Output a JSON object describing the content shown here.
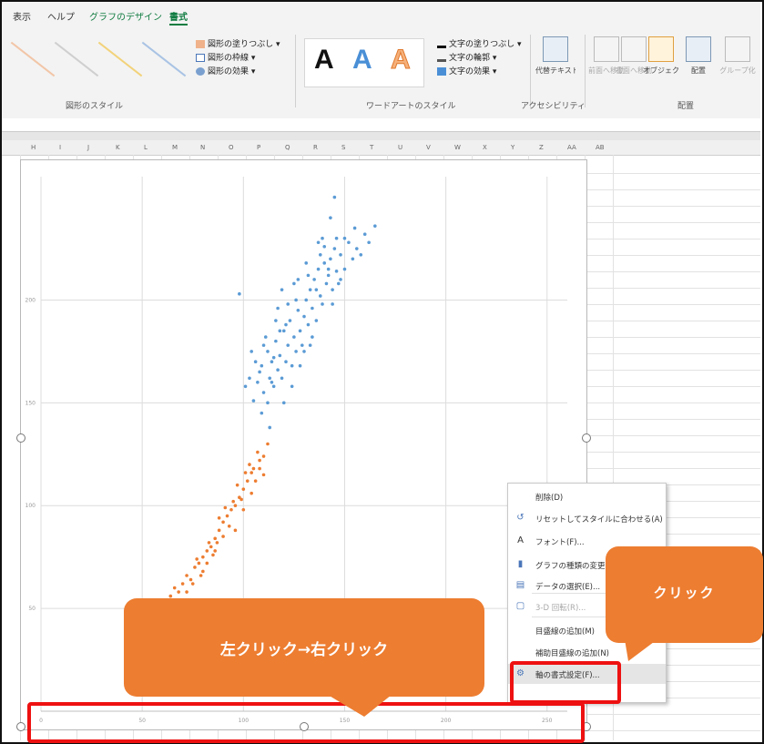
{
  "ribbon": {
    "tabs": [
      "表示",
      "ヘルプ",
      "グラフのデザイン",
      "書式"
    ],
    "shape_styles": {
      "fill": "図形の塗りつぶし",
      "outline": "図形の枠線",
      "effects": "図形の効果",
      "group_label": "図形のスタイル"
    },
    "wordart": {
      "letter": "A",
      "text_fill": "文字の塗りつぶし",
      "text_outline": "文字の輪郭",
      "text_effects": "文字の効果",
      "group_label": "ワードアートのスタイル"
    },
    "accessibility": {
      "alt_text": "代替テキスト",
      "group_label": "アクセシビリティ"
    },
    "arrange": {
      "forward": "前面へ移動",
      "backward": "背面へ移動",
      "selection_pane": "オブジェクトの選択と表示",
      "align": "配置",
      "group": "グループ化",
      "group_label": "配置"
    }
  },
  "sheet": {
    "columns": [
      "H",
      "I",
      "J",
      "K",
      "L",
      "M",
      "N",
      "O",
      "P",
      "Q",
      "R",
      "S",
      "T",
      "U",
      "V",
      "W",
      "X",
      "Y",
      "Z",
      "AA",
      "AB"
    ]
  },
  "chart_data": {
    "type": "scatter",
    "x_tick_labels": [
      "0",
      "50",
      "100",
      "150",
      "200",
      "250"
    ],
    "y_tick_labels": [
      "50",
      "100",
      "150",
      "200"
    ],
    "xlim": [
      0,
      260
    ],
    "ylim": [
      0,
      260
    ],
    "grid": true,
    "series": [
      {
        "color": "#5b9bd5",
        "points": [
          [
            98,
            203
          ],
          [
            101,
            158
          ],
          [
            105,
            151
          ],
          [
            107,
            160
          ],
          [
            109,
            168
          ],
          [
            110,
            155
          ],
          [
            112,
            175
          ],
          [
            113,
            162
          ],
          [
            114,
            170
          ],
          [
            115,
            158
          ],
          [
            116,
            180
          ],
          [
            117,
            166
          ],
          [
            118,
            173
          ],
          [
            119,
            162
          ],
          [
            120,
            185
          ],
          [
            121,
            170
          ],
          [
            122,
            178
          ],
          [
            123,
            190
          ],
          [
            124,
            168
          ],
          [
            125,
            182
          ],
          [
            126,
            175
          ],
          [
            127,
            195
          ],
          [
            128,
            185
          ],
          [
            129,
            178
          ],
          [
            130,
            192
          ],
          [
            131,
            200
          ],
          [
            132,
            188
          ],
          [
            133,
            205
          ],
          [
            134,
            196
          ],
          [
            135,
            210
          ],
          [
            136,
            190
          ],
          [
            137,
            215
          ],
          [
            138,
            202
          ],
          [
            139,
            198
          ],
          [
            140,
            218
          ],
          [
            141,
            208
          ],
          [
            142,
            212
          ],
          [
            143,
            220
          ],
          [
            144,
            205
          ],
          [
            145,
            225
          ],
          [
            146,
            214
          ],
          [
            147,
            208
          ],
          [
            148,
            222
          ],
          [
            150,
            215
          ],
          [
            152,
            228
          ],
          [
            154,
            220
          ],
          [
            156,
            225
          ],
          [
            160,
            232
          ],
          [
            162,
            228
          ],
          [
            165,
            236
          ],
          [
            110,
            178
          ],
          [
            118,
            185
          ],
          [
            124,
            158
          ],
          [
            128,
            168
          ],
          [
            134,
            182
          ],
          [
            140,
            226
          ],
          [
            146,
            230
          ],
          [
            120,
            150
          ],
          [
            112,
            150
          ],
          [
            108,
            165
          ],
          [
            126,
            200
          ],
          [
            132,
            212
          ],
          [
            138,
            222
          ],
          [
            144,
            198
          ],
          [
            116,
            190
          ],
          [
            122,
            198
          ],
          [
            130,
            175
          ],
          [
            136,
            205
          ],
          [
            142,
            215
          ],
          [
            150,
            230
          ],
          [
            155,
            235
          ],
          [
            158,
            222
          ],
          [
            148,
            210
          ],
          [
            114,
            160
          ],
          [
            106,
            170
          ],
          [
            104,
            175
          ],
          [
            119,
            205
          ],
          [
            127,
            210
          ],
          [
            133,
            178
          ],
          [
            139,
            230
          ],
          [
            143,
            240
          ],
          [
            137,
            228
          ],
          [
            131,
            218
          ],
          [
            125,
            208
          ],
          [
            121,
            188
          ],
          [
            117,
            196
          ],
          [
            111,
            182
          ],
          [
            103,
            162
          ],
          [
            109,
            145
          ],
          [
            115,
            172
          ],
          [
            145,
            250
          ],
          [
            113,
            138
          ]
        ]
      },
      {
        "color": "#ed7d31",
        "points": [
          [
            62,
            52
          ],
          [
            64,
            56
          ],
          [
            66,
            60
          ],
          [
            68,
            58
          ],
          [
            70,
            62
          ],
          [
            72,
            66
          ],
          [
            74,
            64
          ],
          [
            76,
            70
          ],
          [
            78,
            72
          ],
          [
            80,
            75
          ],
          [
            82,
            78
          ],
          [
            84,
            80
          ],
          [
            86,
            84
          ],
          [
            88,
            88
          ],
          [
            90,
            92
          ],
          [
            92,
            95
          ],
          [
            94,
            98
          ],
          [
            96,
            100
          ],
          [
            98,
            104
          ],
          [
            100,
            108
          ],
          [
            102,
            112
          ],
          [
            104,
            116
          ],
          [
            106,
            112
          ],
          [
            108,
            118
          ],
          [
            110,
            124
          ],
          [
            90,
            85
          ],
          [
            85,
            76
          ],
          [
            80,
            68
          ],
          [
            72,
            58
          ],
          [
            95,
            102
          ],
          [
            100,
            98
          ],
          [
            105,
            118
          ],
          [
            108,
            122
          ],
          [
            112,
            130
          ],
          [
            82,
            72
          ],
          [
            88,
            94
          ],
          [
            93,
            90
          ],
          [
            97,
            110
          ],
          [
            103,
            120
          ],
          [
            68,
            54
          ],
          [
            75,
            62
          ],
          [
            79,
            66
          ],
          [
            86,
            78
          ],
          [
            101,
            116
          ],
          [
            107,
            126
          ],
          [
            96,
            88
          ],
          [
            110,
            115
          ],
          [
            99,
            103
          ],
          [
            104,
            106
          ],
          [
            91,
            99
          ],
          [
            87,
            82
          ],
          [
            83,
            82
          ],
          [
            77,
            74
          ]
        ]
      }
    ]
  },
  "context_menu": {
    "items": [
      {
        "icon": "",
        "label": "削除(D)",
        "enabled": true
      },
      {
        "icon": "reset-icon",
        "label": "リセットしてスタイルに合わせる(A)",
        "enabled": true
      },
      {
        "icon": "font-icon",
        "label": "フォント(F)...",
        "enabled": true
      },
      {
        "icon": "chart-type-icon",
        "label": "グラフの種類の変更(Y)...",
        "enabled": true
      },
      {
        "icon": "select-data-icon",
        "label": "データの選択(E)...",
        "enabled": true
      },
      {
        "icon": "3d-rotate-icon",
        "label": "3-D 回転(R)...",
        "enabled": false
      },
      {
        "icon": "",
        "label": "目盛線の追加(M)",
        "enabled": true
      },
      {
        "icon": "",
        "label": "補助目盛線の追加(N)",
        "enabled": true
      },
      {
        "icon": "format-axis-icon",
        "label": "軸の書式設定(F)...",
        "enabled": true
      }
    ]
  },
  "callouts": {
    "left_right_click": "左クリック→右クリック",
    "click": "クリック"
  },
  "colors": {
    "callout": "#ed7d31",
    "highlight": "#ee1111",
    "series_blue": "#5b9bd5",
    "series_orange": "#ed7d31"
  }
}
